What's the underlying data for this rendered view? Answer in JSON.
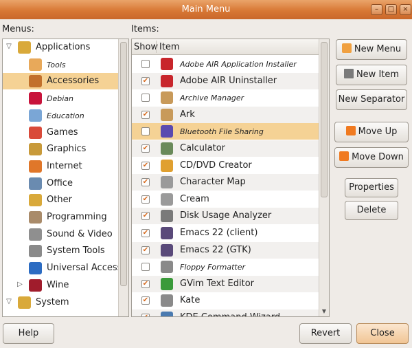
{
  "window": {
    "title": "Main Menu"
  },
  "labels": {
    "menus": "Menus:",
    "items": "Items:"
  },
  "menus_tree": [
    {
      "label": "Applications",
      "level": 0,
      "expander": "open",
      "icon": "applications-icon",
      "color": "#d9a93a"
    },
    {
      "label": "Tools",
      "level": 1,
      "small": true,
      "icon": "folder-icon",
      "color": "#e8a95a"
    },
    {
      "label": "Accessories",
      "level": 1,
      "selected": true,
      "icon": "accessories-icon",
      "color": "#c2702c"
    },
    {
      "label": "Debian",
      "level": 1,
      "small": true,
      "icon": "debian-icon",
      "color": "#c8143c"
    },
    {
      "label": "Education",
      "level": 1,
      "small": true,
      "icon": "education-icon",
      "color": "#7aa6d6"
    },
    {
      "label": "Games",
      "level": 1,
      "icon": "games-icon",
      "color": "#d94a3a"
    },
    {
      "label": "Graphics",
      "level": 1,
      "icon": "graphics-icon",
      "color": "#c89a3a"
    },
    {
      "label": "Internet",
      "level": 1,
      "icon": "internet-icon",
      "color": "#e0772a"
    },
    {
      "label": "Office",
      "level": 1,
      "icon": "office-icon",
      "color": "#6a8bb0"
    },
    {
      "label": "Other",
      "level": 1,
      "icon": "other-icon",
      "color": "#d9a93a"
    },
    {
      "label": "Programming",
      "level": 1,
      "icon": "programming-icon",
      "color": "#a98b6a"
    },
    {
      "label": "Sound & Video",
      "level": 1,
      "icon": "sound-video-icon",
      "color": "#8f8f8f"
    },
    {
      "label": "System Tools",
      "level": 1,
      "icon": "system-tools-icon",
      "color": "#8a8a8a"
    },
    {
      "label": "Universal Access",
      "level": 1,
      "icon": "universal-access-icon",
      "color": "#2c6cc2"
    },
    {
      "label": "Wine",
      "level": 1,
      "expander": "closed",
      "icon": "wine-icon",
      "color": "#a01c2c"
    },
    {
      "label": "System",
      "level": 0,
      "expander": "open",
      "icon": "system-icon",
      "color": "#d9a93a"
    }
  ],
  "items_header": {
    "show": "Show",
    "item": "Item"
  },
  "items": [
    {
      "label": "Adobe AIR Application Installer",
      "checked": false,
      "small": true,
      "icon": "adobe-air-icon",
      "color": "#c8262c"
    },
    {
      "label": "Adobe AIR Uninstaller",
      "checked": true,
      "icon": "adobe-air-icon",
      "color": "#c8262c"
    },
    {
      "label": "Archive Manager",
      "checked": false,
      "small": true,
      "icon": "archive-icon",
      "color": "#c89a5a"
    },
    {
      "label": "Ark",
      "checked": true,
      "icon": "ark-icon",
      "color": "#c89a5a"
    },
    {
      "label": "Bluetooth File Sharing",
      "checked": false,
      "small": true,
      "selected": true,
      "icon": "bluetooth-icon",
      "color": "#5a4ab0"
    },
    {
      "label": "Calculator",
      "checked": true,
      "icon": "calculator-icon",
      "color": "#6a8a5a"
    },
    {
      "label": "CD/DVD Creator",
      "checked": true,
      "icon": "cd-dvd-icon",
      "color": "#e0a030"
    },
    {
      "label": "Character Map",
      "checked": true,
      "icon": "character-map-icon",
      "color": "#9a9a9a"
    },
    {
      "label": "Cream",
      "checked": true,
      "icon": "cream-icon",
      "color": "#9a9a9a"
    },
    {
      "label": "Disk Usage Analyzer",
      "checked": true,
      "icon": "disk-usage-icon",
      "color": "#7a7a7a"
    },
    {
      "label": "Emacs 22 (client)",
      "checked": true,
      "icon": "emacs-icon",
      "color": "#5a4a7a"
    },
    {
      "label": "Emacs 22 (GTK)",
      "checked": true,
      "icon": "emacs-icon",
      "color": "#5a4a7a"
    },
    {
      "label": "Floppy Formatter",
      "checked": false,
      "small": true,
      "icon": "floppy-icon",
      "color": "#8a8a8a"
    },
    {
      "label": "GVim Text Editor",
      "checked": true,
      "icon": "gvim-icon",
      "color": "#3a9a3a"
    },
    {
      "label": "Kate",
      "checked": true,
      "icon": "kate-icon",
      "color": "#8a8a8a"
    },
    {
      "label": "KDE Command Wizard",
      "checked": true,
      "icon": "kde-icon",
      "color": "#4a7ab0"
    }
  ],
  "buttons": {
    "new_menu": "New Menu",
    "new_item": "New Item",
    "new_separator": "New Separator",
    "move_up": "Move Up",
    "move_down": "Move Down",
    "properties": "Properties",
    "delete": "Delete",
    "help": "Help",
    "revert": "Revert",
    "close": "Close"
  }
}
